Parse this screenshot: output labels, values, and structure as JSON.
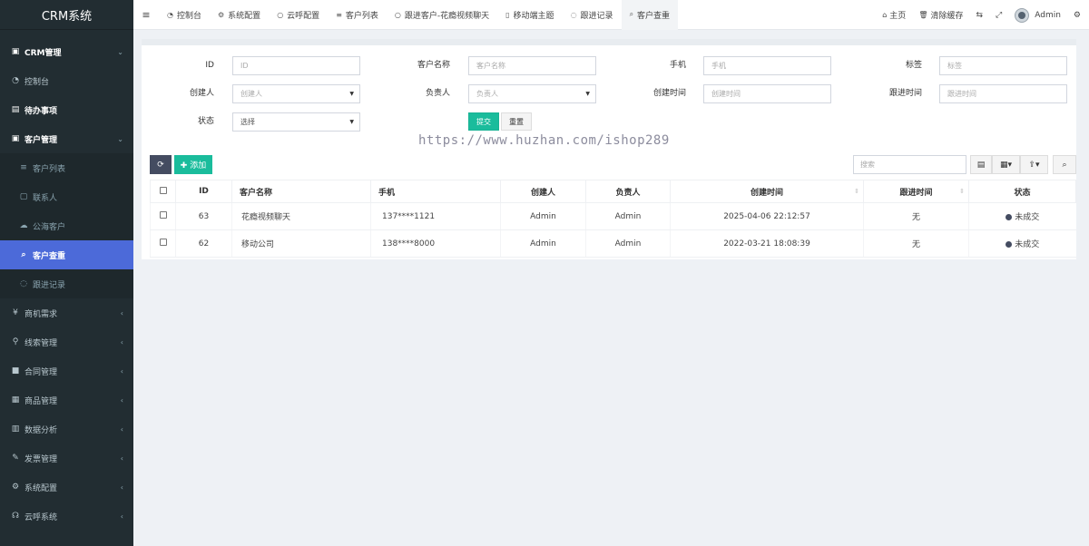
{
  "app": {
    "title": "CRM系统"
  },
  "sidebar": {
    "items": [
      {
        "label": "CRM管理",
        "icon": "id-card-icon",
        "glyph": "▣",
        "arrow": "⌄",
        "kind": "group"
      },
      {
        "label": "控制台",
        "icon": "dashboard-icon",
        "glyph": "◔",
        "kind": "normal"
      },
      {
        "label": "待办事项",
        "icon": "calendar-icon",
        "glyph": "▤",
        "kind": "group-plain"
      },
      {
        "label": "客户管理",
        "icon": "id-card-icon",
        "glyph": "▣",
        "arrow": "⌄",
        "kind": "group"
      },
      {
        "label": "客户列表",
        "icon": "list-icon",
        "glyph": "≡",
        "kind": "sub"
      },
      {
        "label": "联系人",
        "icon": "contact-icon",
        "glyph": "▢",
        "kind": "sub"
      },
      {
        "label": "公海客户",
        "icon": "cloud-icon",
        "glyph": "☁",
        "kind": "sub"
      },
      {
        "label": "客户查重",
        "icon": "search-icon",
        "glyph": "⌕",
        "kind": "sub-active"
      },
      {
        "label": "跟进记录",
        "icon": "chat-icon",
        "glyph": "◌",
        "kind": "sub"
      },
      {
        "label": "商机需求",
        "icon": "yen-icon",
        "glyph": "¥",
        "arrow": "‹",
        "kind": "normal"
      },
      {
        "label": "线索管理",
        "icon": "link-icon",
        "glyph": "⚲",
        "arrow": "‹",
        "kind": "normal"
      },
      {
        "label": "合同管理",
        "icon": "bookmark-icon",
        "glyph": "■",
        "arrow": "‹",
        "kind": "normal"
      },
      {
        "label": "商品管理",
        "icon": "product-icon",
        "glyph": "▦",
        "arrow": "‹",
        "kind": "normal"
      },
      {
        "label": "数据分析",
        "icon": "bar-chart-icon",
        "glyph": "▥",
        "arrow": "‹",
        "kind": "normal"
      },
      {
        "label": "发票管理",
        "icon": "gavel-icon",
        "glyph": "✎",
        "arrow": "‹",
        "kind": "normal"
      },
      {
        "label": "系统配置",
        "icon": "cogs-icon",
        "glyph": "⚙",
        "arrow": "‹",
        "kind": "normal"
      },
      {
        "label": "云呼系统",
        "icon": "headphones-icon",
        "glyph": "☊",
        "arrow": "‹",
        "kind": "normal"
      }
    ]
  },
  "topbar": {
    "menu_glyph": "≡",
    "tabs": [
      {
        "label": "控制台",
        "icon": "dashboard-icon",
        "glyph": "◔"
      },
      {
        "label": "系统配置",
        "icon": "gear-icon",
        "glyph": "⚙"
      },
      {
        "label": "云呼配置",
        "icon": "circle-icon",
        "glyph": "○"
      },
      {
        "label": "客户列表",
        "icon": "list-icon",
        "glyph": "≡"
      },
      {
        "label": "跟进客户-花瘾视频聊天",
        "icon": "circle-icon",
        "glyph": "○"
      },
      {
        "label": "移动端主题",
        "icon": "mobile-icon",
        "glyph": "▯"
      },
      {
        "label": "跟进记录",
        "icon": "chat-icon",
        "glyph": "◌"
      },
      {
        "label": "客户查重",
        "icon": "search-icon",
        "glyph": "⌕",
        "active": true
      }
    ],
    "right": {
      "home": "主页",
      "clear_cache": "清除缓存",
      "translate_glyph": "⇆",
      "fullscreen_glyph": "⤢",
      "user": "Admin",
      "settings_glyph": "⚙"
    }
  },
  "filter": {
    "id": {
      "label": "ID",
      "placeholder": "ID"
    },
    "customer_name": {
      "label": "客户名称",
      "placeholder": "客户名称"
    },
    "phone": {
      "label": "手机",
      "placeholder": "手机"
    },
    "tag": {
      "label": "标签",
      "placeholder": "标签"
    },
    "creator": {
      "label": "创建人",
      "placeholder": "创建人"
    },
    "owner": {
      "label": "负责人",
      "placeholder": "负责人"
    },
    "create_time": {
      "label": "创建时间",
      "placeholder": "创建时间"
    },
    "follow_time": {
      "label": "跟进时间",
      "placeholder": "跟进时间"
    },
    "status": {
      "label": "状态",
      "value": "选择"
    },
    "submit": "提交",
    "reset": "重置"
  },
  "watermark": "https://www.huzhan.com/ishop289",
  "toolbar": {
    "refresh_glyph": "⟳",
    "add": "✚ 添加",
    "search_placeholder": "搜索",
    "toggle_glyph": "▤",
    "columns_glyph": "▦▾",
    "export_glyph": "⇪▾",
    "search_glyph": "⌕"
  },
  "table": {
    "headers": [
      "ID",
      "客户名称",
      "手机",
      "创建人",
      "负责人",
      "创建时间",
      "跟进时间",
      "状态"
    ],
    "rows": [
      {
        "id": "63",
        "name": "花瘾视频聊天",
        "phone": "137****1121",
        "creator": "Admin",
        "owner": "Admin",
        "create_time": "2025-04-06 22:12:57",
        "follow_time": "无",
        "status": "未成交"
      },
      {
        "id": "62",
        "name": "移动公司",
        "phone": "138****8000",
        "creator": "Admin",
        "owner": "Admin",
        "create_time": "2022-03-21 18:08:39",
        "follow_time": "无",
        "status": "未成交"
      }
    ]
  }
}
